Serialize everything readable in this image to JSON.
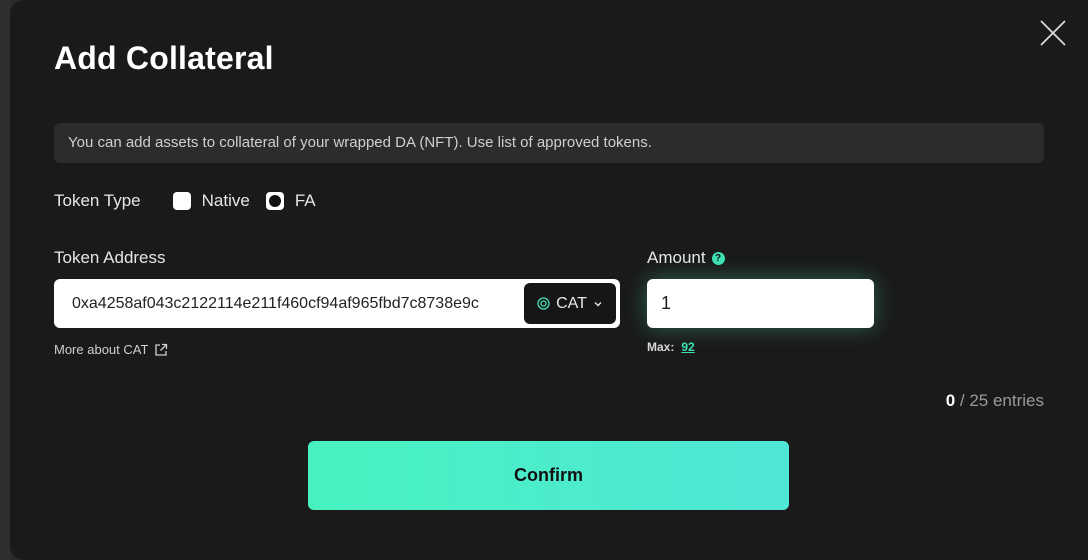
{
  "modal": {
    "title": "Add Collateral",
    "info_text": "You can add assets to collateral of your wrapped DA (NFT). Use list of approved tokens."
  },
  "token_type": {
    "label": "Token Type",
    "options": [
      {
        "label": "Native",
        "selected": false
      },
      {
        "label": "FA",
        "selected": true
      }
    ]
  },
  "token_address": {
    "label": "Token Address",
    "value": "0xa4258af043c2122114e211f460cf94af965fbd7c8738e9c",
    "token_symbol": "CAT",
    "more_link": "More about CAT"
  },
  "amount": {
    "label": "Amount",
    "help_icon_glyph": "?",
    "value": "1",
    "max_label": "Max:",
    "max_value": "92"
  },
  "entries": {
    "current": "0",
    "separator": " / ",
    "total_text": "25 entries"
  },
  "confirm_label": "Confirm",
  "colors": {
    "accent": "#3fe0b4",
    "background": "#1a1a1a",
    "banner": "#2c2c2c"
  }
}
